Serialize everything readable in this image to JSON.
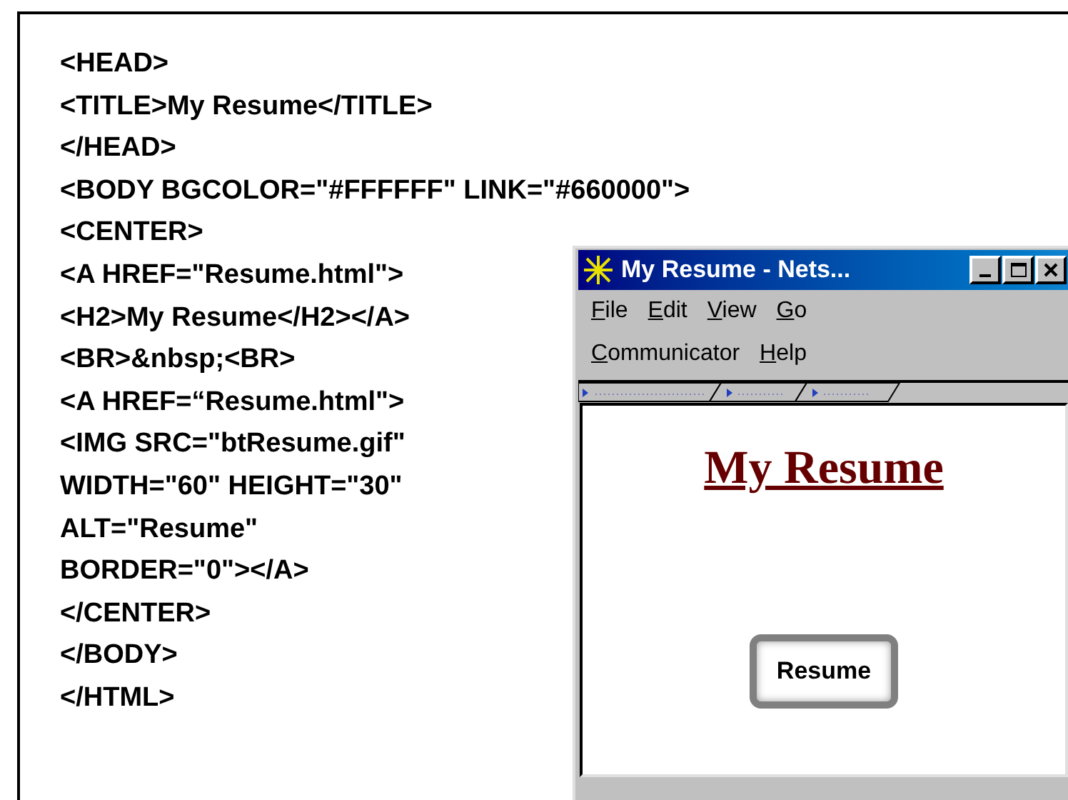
{
  "code_lines": [
    "<HEAD>",
    "<TITLE>My Resume</TITLE>",
    "</HEAD>",
    "<BODY BGCOLOR=\"#FFFFFF\" LINK=\"#660000\">",
    "<CENTER>",
    "<A HREF=\"Resume.html\">",
    "<H2>My Resume</H2></A>",
    "<BR>&nbsp;<BR>",
    "<A HREF=“Resume.html\">",
    "<IMG SRC=\"btResume.gif\"",
    "WIDTH=\"60\" HEIGHT=\"30\"",
    "ALT=\"Resume\"",
    "BORDER=\"0\"></A>",
    "</CENTER>",
    "</BODY>",
    "</HTML>"
  ],
  "browser": {
    "title": "My Resume - Nets...",
    "window_buttons": [
      {
        "kind": "minimize"
      },
      {
        "kind": "maximize"
      },
      {
        "kind": "close"
      }
    ],
    "menu_rows": [
      [
        "File",
        "Edit",
        "View",
        "Go"
      ],
      [
        "Communicator",
        "Help"
      ]
    ],
    "page": {
      "heading": "My Resume",
      "image_button": "Resume"
    }
  }
}
